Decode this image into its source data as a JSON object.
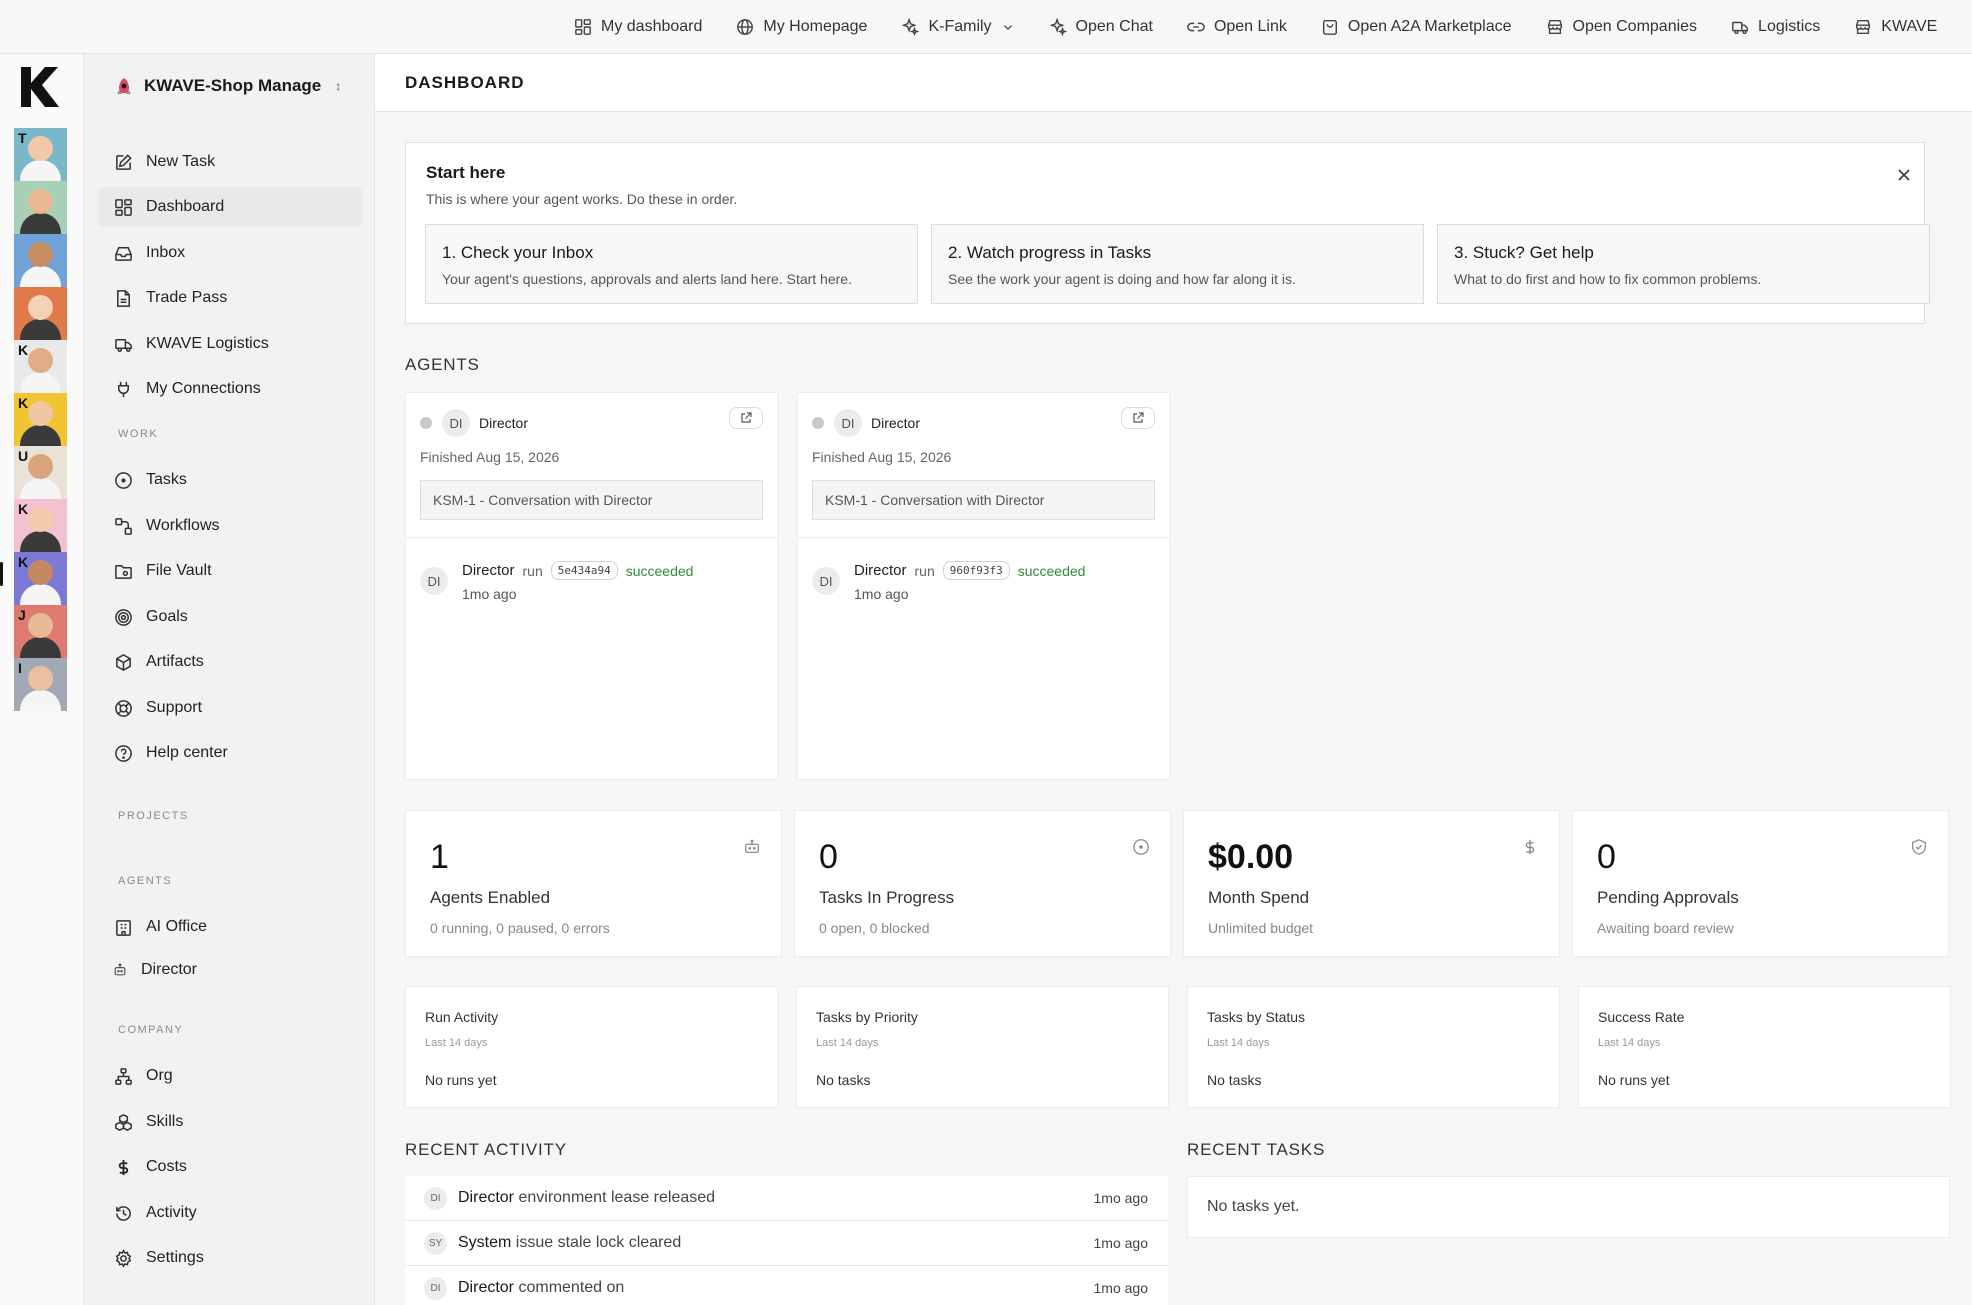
{
  "topnav": [
    {
      "label": "My dashboard",
      "icon": "dashboard-icon"
    },
    {
      "label": "My Homepage",
      "icon": "globe-icon"
    },
    {
      "label": "K-Family",
      "icon": "sparkle-icon"
    },
    {
      "label": "Open Chat",
      "icon": "sparkle-icon"
    },
    {
      "label": "Open Link",
      "icon": "link-icon"
    },
    {
      "label": "Open A2A Marketplace",
      "icon": "bag-icon"
    },
    {
      "label": "Open Companies",
      "icon": "store-icon"
    },
    {
      "label": "Logistics",
      "icon": "truck-icon"
    },
    {
      "label": "KWAVE",
      "icon": "store-icon"
    }
  ],
  "rail": {
    "logo": "K",
    "avatars": [
      {
        "letter": "T",
        "color": "#7ab8c9"
      },
      {
        "letter": "",
        "color": "#a7d0b6"
      },
      {
        "letter": "",
        "color": "#6fa2d6"
      },
      {
        "letter": "",
        "color": "#e07a4a"
      },
      {
        "letter": "K",
        "color": "#e9e9e9"
      },
      {
        "letter": "K",
        "color": "#f0c531"
      },
      {
        "letter": "U",
        "color": "#e8e3d6"
      },
      {
        "letter": "K",
        "color": "#f3c1cf"
      },
      {
        "letter": "K",
        "color": "#7d79d6"
      },
      {
        "letter": "J",
        "color": "#de7a6e"
      },
      {
        "letter": "I",
        "color": "#a3a9b4"
      }
    ]
  },
  "sidebar": {
    "workspace": "KWAVE-Shop Manage",
    "primary": [
      {
        "label": "New Task",
        "icon": "edit-icon"
      },
      {
        "label": "Dashboard",
        "icon": "dashboard-icon"
      },
      {
        "label": "Inbox",
        "icon": "inbox-icon"
      },
      {
        "label": "Trade Pass",
        "icon": "document-icon"
      },
      {
        "label": "KWAVE Logistics",
        "icon": "truck-icon"
      },
      {
        "label": "My Connections",
        "icon": "plug-icon"
      }
    ],
    "work_label": "WORK",
    "work": [
      {
        "label": "Tasks",
        "icon": "circle-dot-icon"
      },
      {
        "label": "Workflows",
        "icon": "workflow-icon"
      },
      {
        "label": "File Vault",
        "icon": "folder-icon"
      },
      {
        "label": "Goals",
        "icon": "target-icon"
      },
      {
        "label": "Artifacts",
        "icon": "cube-icon"
      },
      {
        "label": "Support",
        "icon": "lifebuoy-icon"
      },
      {
        "label": "Help center",
        "icon": "help-icon"
      }
    ],
    "projects_label": "PROJECTS",
    "agents_label": "AGENTS",
    "agents": [
      {
        "label": "AI Office",
        "icon": "building-icon"
      },
      {
        "label": "Director",
        "icon": "bot-icon"
      }
    ],
    "company_label": "COMPANY",
    "company": [
      {
        "label": "Org",
        "icon": "org-icon"
      },
      {
        "label": "Skills",
        "icon": "boxes-icon"
      },
      {
        "label": "Costs",
        "icon": "dollar-icon"
      },
      {
        "label": "Activity",
        "icon": "history-icon"
      },
      {
        "label": "Settings",
        "icon": "gear-icon"
      }
    ]
  },
  "main": {
    "title": "DASHBOARD",
    "start": {
      "title": "Start here",
      "subtitle": "This is where your agent works. Do these in order.",
      "steps": [
        {
          "title": "1. Check your Inbox",
          "desc": "Your agent's questions, approvals and alerts land here. Start here."
        },
        {
          "title": "2. Watch progress in Tasks",
          "desc": "See the work your agent is doing and how far along it is."
        },
        {
          "title": "3. Stuck? Get help",
          "desc": "What to do first and how to fix common problems."
        }
      ]
    },
    "agents_heading": "AGENTS",
    "agents": [
      {
        "initials": "DI",
        "name": "Director",
        "finished": "Finished Aug 15, 2026",
        "conversation": "KSM-1 - Conversation with Director",
        "run_name": "Director",
        "run_word": "run",
        "hash": "5e434a94",
        "status": "succeeded",
        "time": "1mo ago"
      },
      {
        "initials": "DI",
        "name": "Director",
        "finished": "Finished Aug 15, 2026",
        "conversation": "KSM-1 - Conversation with Director",
        "run_name": "Director",
        "run_word": "run",
        "hash": "960f93f3",
        "status": "succeeded",
        "time": "1mo ago"
      }
    ],
    "stats": [
      {
        "value": "1",
        "label": "Agents Enabled",
        "sub": "0 running, 0 paused, 0 errors",
        "icon": "bot-icon"
      },
      {
        "value": "0",
        "label": "Tasks In Progress",
        "sub": "0 open, 0 blocked",
        "icon": "circle-dot-icon"
      },
      {
        "value": "$0.00",
        "label": "Month Spend",
        "sub": "Unlimited budget",
        "icon": "dollar-icon"
      },
      {
        "value": "0",
        "label": "Pending Approvals",
        "sub": "Awaiting board review",
        "icon": "shield-icon"
      }
    ],
    "charts": [
      {
        "title": "Run Activity",
        "sub": "Last 14 days",
        "empty": "No runs yet"
      },
      {
        "title": "Tasks by Priority",
        "sub": "Last 14 days",
        "empty": "No tasks"
      },
      {
        "title": "Tasks by Status",
        "sub": "Last 14 days",
        "empty": "No tasks"
      },
      {
        "title": "Success Rate",
        "sub": "Last 14 days",
        "empty": "No runs yet"
      }
    ],
    "recent_activity_heading": "RECENT ACTIVITY",
    "recent_activity": [
      {
        "initials": "DI",
        "actor": "Director",
        "action": "environment lease released",
        "time": "1mo ago"
      },
      {
        "initials": "SY",
        "actor": "System",
        "action": "issue stale lock cleared",
        "time": "1mo ago"
      },
      {
        "initials": "DI",
        "actor": "Director",
        "action": "commented on",
        "time": "1mo ago"
      }
    ],
    "recent_tasks_heading": "RECENT TASKS",
    "recent_tasks_empty": "No tasks yet."
  }
}
